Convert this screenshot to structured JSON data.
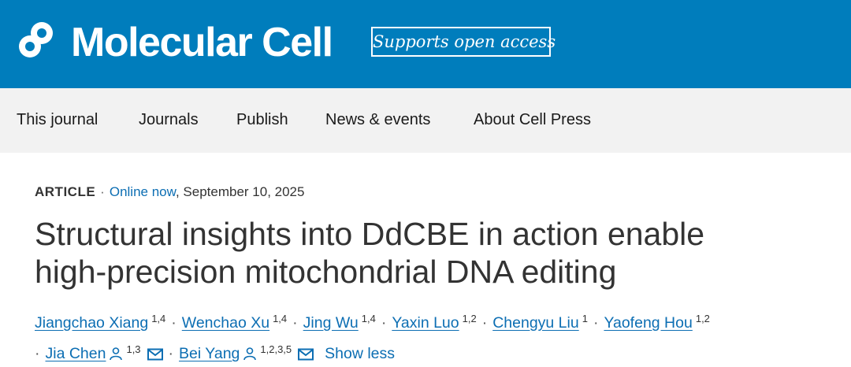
{
  "header": {
    "logo_text": "Molecular Cell",
    "open_access_badge": "Supports open access",
    "brand_color": "#007dbc"
  },
  "nav": {
    "items": [
      {
        "label": "This journal"
      },
      {
        "label": "Journals"
      },
      {
        "label": "Publish"
      },
      {
        "label": "News & events"
      },
      {
        "label": "About Cell Press"
      }
    ]
  },
  "article": {
    "type": "ARTICLE",
    "separator": "·",
    "status": "Online now",
    "date": ", September 10, 2025",
    "title_line1": "Structural insights into DdCBE in action enable",
    "title_line2": "high-precision mitochondrial DNA editing",
    "authors": [
      {
        "name": "Jiangchao Xiang",
        "aff": "1,4"
      },
      {
        "name": "Wenchao Xu",
        "aff": "1,4"
      },
      {
        "name": "Jing Wu",
        "aff": "1,4"
      },
      {
        "name": "Yaxin Luo",
        "aff": "1,2"
      },
      {
        "name": "Chengyu Liu",
        "aff": "1"
      },
      {
        "name": "Yaofeng Hou",
        "aff": "1,2"
      },
      {
        "name": "Jia Chen",
        "aff": "1,3",
        "icons": [
          "person-icon",
          "email-icon"
        ]
      },
      {
        "name": "Bei Yang",
        "aff": "1,2,3,5",
        "icons": [
          "person-icon",
          "email-icon"
        ]
      }
    ],
    "show_less": "Show less",
    "link_color": "#0c6eb3"
  }
}
